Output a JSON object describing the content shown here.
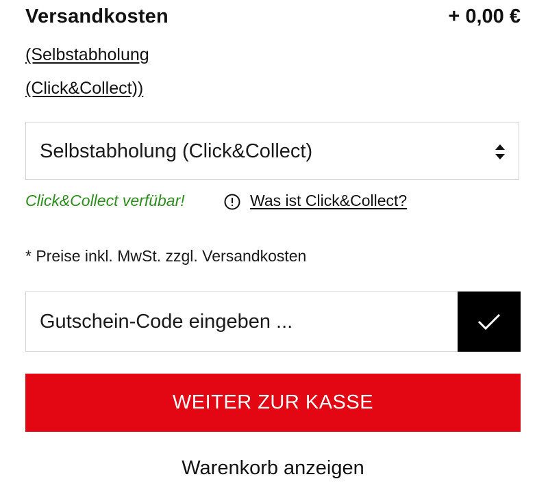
{
  "shipping": {
    "label": "Versandkosten",
    "price": "+ 0,00 €",
    "method_link": "(Selbstabholung (Click&Collect))"
  },
  "delivery_select": {
    "selected": "Selbstabholung (Click&Collect)",
    "arrows_icon": "sort-arrows-icon"
  },
  "availability": {
    "status": "Click&Collect verfübar!",
    "status_color": "#2e8b1e",
    "info_icon": "info-circle-icon",
    "info_link": "Was ist Click&Collect?"
  },
  "price_note": "* Preise inkl. MwSt. zzgl. Versandkosten",
  "coupon": {
    "placeholder": "Gutschein-Code eingeben ...",
    "submit_icon": "checkmark-icon"
  },
  "checkout": {
    "label": "WEITER ZUR KASSE",
    "color": "#e30613"
  },
  "cart_link": "Warenkorb anzeigen"
}
